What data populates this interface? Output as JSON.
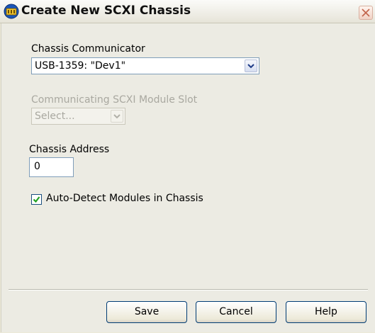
{
  "window": {
    "title": "Create New SCXI Chassis"
  },
  "form": {
    "communicator": {
      "label": "Chassis Communicator",
      "value": "USB-1359: \"Dev1\""
    },
    "module_slot": {
      "label": "Communicating SCXI Module Slot",
      "placeholder": "Select...",
      "enabled": false
    },
    "address": {
      "label": "Chassis Address",
      "value": "0"
    },
    "auto_detect": {
      "label": "Auto-Detect Modules in Chassis",
      "checked": true
    }
  },
  "buttons": {
    "save": "Save",
    "cancel": "Cancel",
    "help": "Help"
  },
  "icons": {
    "app": "scxi-chassis-icon",
    "close": "close-icon",
    "dropdown": "chevron-down-icon",
    "check": "checkmark-icon"
  },
  "colors": {
    "dialog_bg": "#ecebe3",
    "input_border": "#7f9db9",
    "check_green": "#21a121"
  }
}
